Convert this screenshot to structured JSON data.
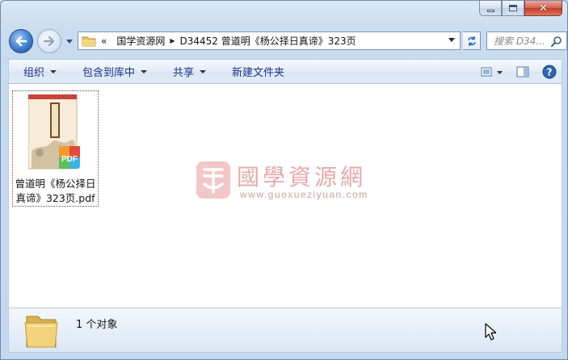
{
  "window": {
    "controls": {
      "minimize": "minimize",
      "maximize": "maximize",
      "close": "✕"
    }
  },
  "address_bar": {
    "overflow": "«",
    "crumbs": [
      "国学资源网",
      "D34452 曾道明《杨公择日真谛》323页"
    ]
  },
  "search": {
    "placeholder": "搜索 D34..."
  },
  "toolbar": {
    "items": [
      {
        "label": "组织",
        "has_dropdown": true
      },
      {
        "label": "包含到库中",
        "has_dropdown": true
      },
      {
        "label": "共享",
        "has_dropdown": true
      },
      {
        "label": "新建文件夹",
        "has_dropdown": false
      }
    ],
    "icons": [
      "view-options-icon",
      "preview-pane-icon",
      "help-icon"
    ]
  },
  "files": [
    {
      "name": "曾道明《杨公择日真谛》323页.pdf",
      "line1": "曾道明《杨公择日",
      "line2": "真谛》323页.pdf",
      "type": "pdf",
      "badge": "PDF"
    }
  ],
  "watermark": {
    "title": "國學資源網",
    "url": "www.guoxueziyuan.com"
  },
  "status": {
    "count_text": "1 个对象"
  },
  "colors": {
    "toolbar_text": "#1e3287",
    "accent_blue": "#3a78c8",
    "close_red": "#c03d27",
    "watermark": "#e6a9a9"
  }
}
